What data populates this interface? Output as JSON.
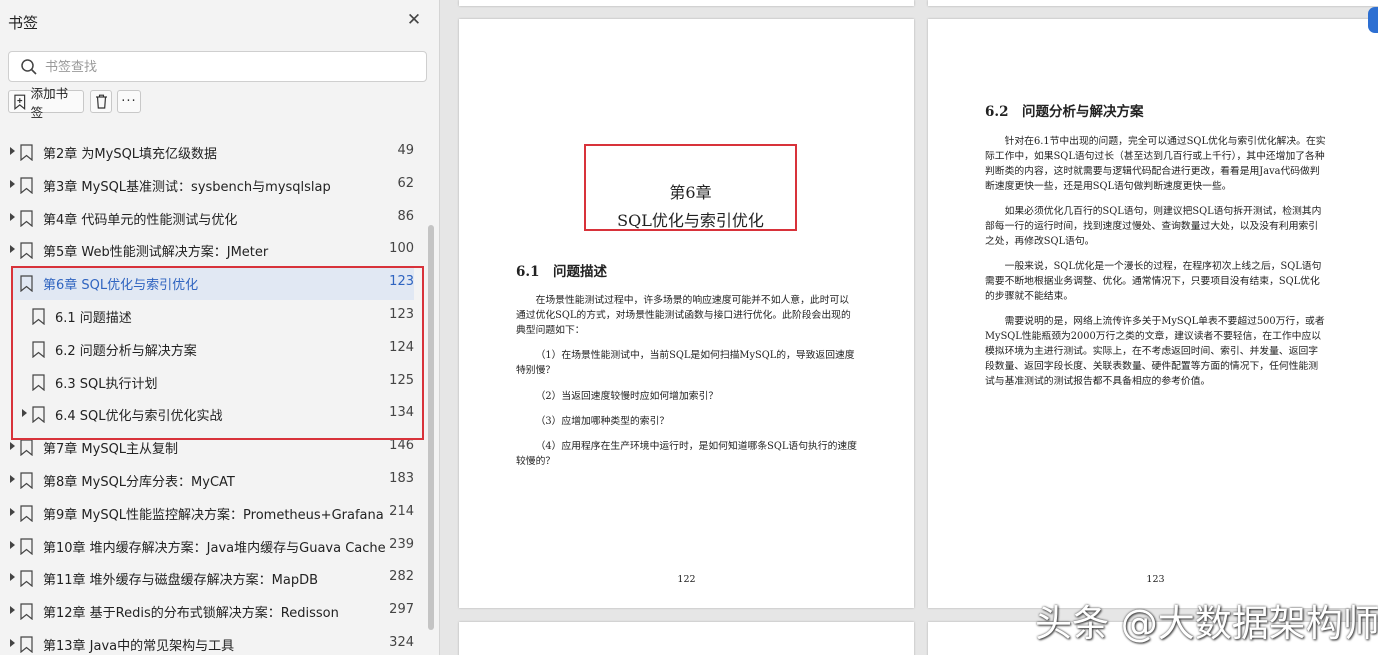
{
  "sidebar": {
    "title": "书签",
    "search_placeholder": "书签查找",
    "add_label": "添加书签",
    "more_label": "···",
    "items": [
      {
        "label": "第2章 为MySQL填充亿级数据",
        "page": "49",
        "level": 0,
        "expand": true
      },
      {
        "label": "第3章 MySQL基准测试：sysbench与mysqlslap",
        "page": "62",
        "level": 0,
        "expand": true
      },
      {
        "label": "第4章 代码单元的性能测试与优化",
        "page": "86",
        "level": 0,
        "expand": true
      },
      {
        "label": "第5章 Web性能测试解决方案：JMeter",
        "page": "100",
        "level": 0,
        "expand": true
      },
      {
        "label": "第6章 SQL优化与索引优化",
        "page": "123",
        "level": 0,
        "expand": false,
        "active": true
      },
      {
        "label": "6.1 问题描述",
        "page": "123",
        "level": 1,
        "expand": false
      },
      {
        "label": "6.2 问题分析与解决方案",
        "page": "124",
        "level": 1,
        "expand": false
      },
      {
        "label": "6.3 SQL执行计划",
        "page": "125",
        "level": 1,
        "expand": false
      },
      {
        "label": "6.4 SQL优化与索引优化实战",
        "page": "134",
        "level": 1,
        "expand": true
      },
      {
        "label": "第7章 MySQL主从复制",
        "page": "146",
        "level": 0,
        "expand": true
      },
      {
        "label": "第8章 MySQL分库分表：MyCAT",
        "page": "183",
        "level": 0,
        "expand": true
      },
      {
        "label": "第9章 MySQL性能监控解决方案：Prometheus+Grafana",
        "page": "214",
        "level": 0,
        "expand": true
      },
      {
        "label": "第10章 堆内缓存解决方案：Java堆内缓存与Guava Cache",
        "page": "239",
        "level": 0,
        "expand": true
      },
      {
        "label": "第11章 堆外缓存与磁盘缓存解决方案：MapDB",
        "page": "282",
        "level": 0,
        "expand": true
      },
      {
        "label": "第12章 基于Redis的分布式锁解决方案：Redisson",
        "page": "297",
        "level": 0,
        "expand": true
      },
      {
        "label": "第13章 Java中的常见架构与工具",
        "page": "324",
        "level": 0,
        "expand": true
      }
    ]
  },
  "page_left": {
    "chapter_line1": "第6章",
    "chapter_line2": "SQL优化与索引优化",
    "section": "6.1　问题描述",
    "p1": "在场景性能测试过程中，许多场景的响应速度可能并不如人意，此时可以通过优化SQL的方式，对场景性能测试函数与接口进行优化。此阶段会出现的典型问题如下：",
    "p2": "（1）在场景性能测试中，当前SQL是如何扫描MySQL的，导致返回速度特别慢？",
    "p3": "（2）当返回速度较慢时应如何增加索引？",
    "p4": "（3）应增加哪种类型的索引？",
    "p5": "（4）应用程序在生产环境中运行时，是如何知道哪条SQL语句执行的速度较慢的？",
    "page_number": "122"
  },
  "page_right": {
    "section": "6.2　问题分析与解决方案",
    "p1": "针对在6.1节中出现的问题，完全可以通过SQL优化与索引优化解决。在实际工作中，如果SQL语句过长（甚至达到几百行或上千行），其中还增加了各种判断类的内容，这时就需要与逻辑代码配合进行更改，看看是用Java代码做判断速度更快一些，还是用SQL语句做判断速度更快一些。",
    "p2": "如果必须优化几百行的SQL语句，则建议把SQL语句拆开测试，检测其内部每一行的运行时间，找到速度过慢处、查询数量过大处，以及没有利用索引之处，再修改SQL语句。",
    "p3": "一般来说，SQL优化是一个漫长的过程，在程序初次上线之后，SQL语句需要不断地根据业务调整、优化。通常情况下，只要项目没有结束，SQL优化的步骤就不能结束。",
    "p4": "需要说明的是，网络上流传许多关于MySQL单表不要超过500万行，或者MySQL性能瓶颈为2000万行之类的文章，建议读者不要轻信，在工作中应以模拟环境为主进行测试。实际上，在不考虑返回时间、索引、并发量、返回字段数量、返回字段长度、关联表数量、硬件配置等方面的情况下，任何性能测试与基准测试的测试报告都不具备相应的参考价值。",
    "page_number": "123"
  },
  "watermark": "头条 @大数据架构师",
  "colors": {
    "accent": "#2f64c0",
    "highlight": "#d8323a"
  }
}
